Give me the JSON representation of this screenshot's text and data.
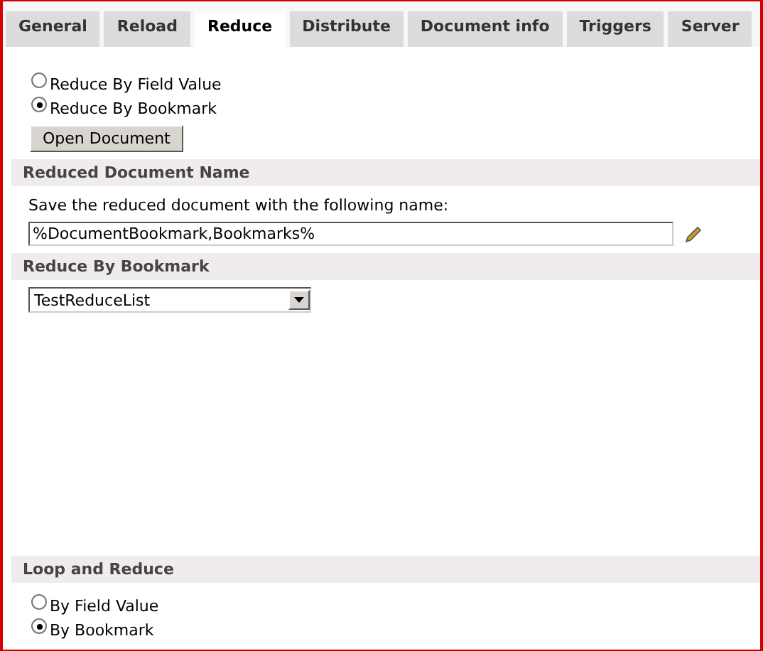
{
  "tabs": [
    {
      "label": "General",
      "selected": false
    },
    {
      "label": "Reload",
      "selected": false
    },
    {
      "label": "Reduce",
      "selected": true
    },
    {
      "label": "Distribute",
      "selected": false
    },
    {
      "label": "Document info",
      "selected": false
    },
    {
      "label": "Triggers",
      "selected": false
    },
    {
      "label": "Server",
      "selected": false
    }
  ],
  "reduce_mode": [
    {
      "label": "Reduce By Field Value",
      "selected": false
    },
    {
      "label": "Reduce By Bookmark",
      "selected": true
    }
  ],
  "open_document_button": "Open Document",
  "reduced_document_name": {
    "header": "Reduced Document Name",
    "instruction": "Save the reduced document with the following name:",
    "value": "%DocumentBookmark,Bookmarks%"
  },
  "reduce_by_bookmark": {
    "header": "Reduce By Bookmark",
    "value": "TestReduceList"
  },
  "loop_and_reduce": {
    "header": "Loop and Reduce",
    "options": [
      {
        "label": "By Field Value",
        "selected": false
      },
      {
        "label": "By Bookmark",
        "selected": true
      }
    ]
  }
}
